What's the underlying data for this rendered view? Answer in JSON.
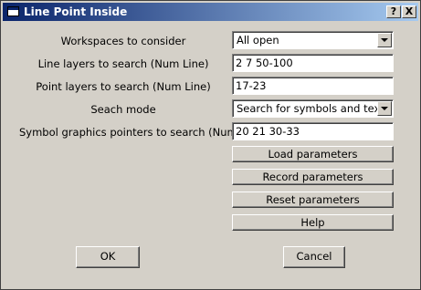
{
  "window": {
    "title": "Line Point Inside",
    "help_glyph": "?",
    "close_glyph": "X"
  },
  "form": {
    "workspaces_label": "Workspaces to consider",
    "workspaces_value": "All open",
    "line_layers_label": "Line layers to search (Num Line)",
    "line_layers_value": "2 7 50-100",
    "point_layers_label": "Point layers to search (Num Line)",
    "point_layers_value": "17-23",
    "search_mode_label": "Seach mode",
    "search_mode_value": "Search for symbols and text",
    "symbol_pointers_label": "Symbol graphics pointers to search (Num Line)",
    "symbol_pointers_value": "20 21 30-33"
  },
  "actions": {
    "load": "Load parameters",
    "record": "Record parameters",
    "reset": "Reset parameters",
    "help": "Help"
  },
  "footer": {
    "ok": "OK",
    "cancel": "Cancel"
  },
  "icons": {
    "window_icon": "window-icon",
    "dropdown": "chevron-down-icon"
  },
  "colors": {
    "face": "#d4d0c8",
    "title_start": "#0a246a",
    "title_end": "#a6caf0"
  }
}
